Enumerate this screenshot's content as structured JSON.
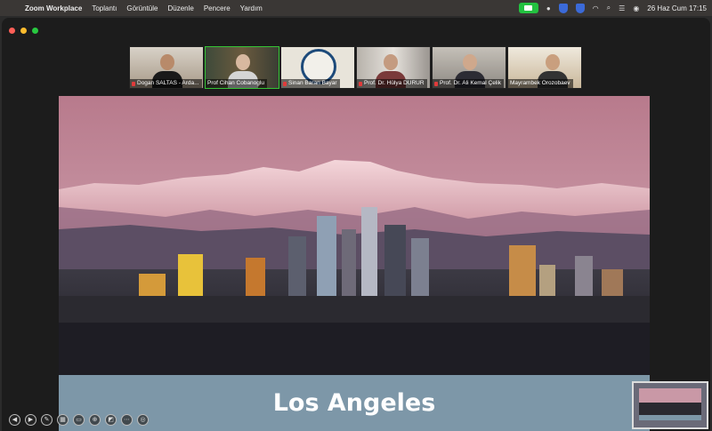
{
  "menubar": {
    "apple": "",
    "app": "Zoom Workplace",
    "menus": [
      "Toplantı",
      "Görüntüle",
      "Düzenle",
      "Pencere",
      "Yardım"
    ],
    "clock": "26 Haz Cum  17:15",
    "icons": [
      "camera-icon",
      "chat-icon",
      "shield-icon",
      "shield-icon",
      "wifi-icon",
      "search-icon",
      "control-center-icon",
      "siri-icon"
    ]
  },
  "participants": [
    {
      "name": "Dogan SALTAS - Arda...",
      "muted": true,
      "active": false
    },
    {
      "name": "Prof Cihan Cobanoglu",
      "muted": false,
      "active": true
    },
    {
      "name": "Sinan Baran Bayar",
      "muted": true,
      "active": false
    },
    {
      "name": "Prof. Dr. Hülya DURUR",
      "muted": true,
      "active": false
    },
    {
      "name": "Prof. Dr. Ali Kemal Çelik",
      "muted": true,
      "active": false
    },
    {
      "name": "Mayrambek Orozobaev",
      "muted": false,
      "active": false
    }
  ],
  "slide": {
    "title": "Los Angeles"
  },
  "colors": {
    "accent_green": "#23c140",
    "slide_caption_bg": "#7d97a8",
    "traffic_red": "#ff5f57",
    "traffic_yellow": "#febc2e",
    "traffic_green": "#28c840"
  }
}
